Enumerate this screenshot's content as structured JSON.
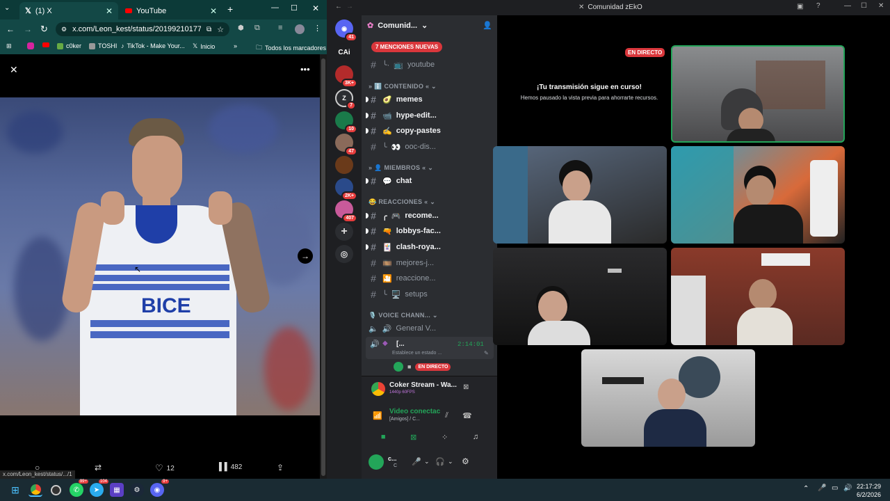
{
  "chrome": {
    "tabs": [
      {
        "label": "(1) X"
      },
      {
        "label": "YouTube"
      }
    ],
    "url": "x.com/Leon_kest/status/2019921017779...",
    "bookmarks": [
      "c0ker",
      "TOSHI",
      "TikTok - Make Your...",
      "Inicio"
    ],
    "bookmarks_more": "»",
    "all_bookmarks": "Todos los marcadores",
    "status_url": "x.com/Leon_kest/status/.../1",
    "actions": {
      "likes": "12",
      "views": "482"
    }
  },
  "discord": {
    "window_title": "Comunidad zEkO",
    "server_name": "Comunid...",
    "mentions_banner": "7 MENCIONES NUEVAS",
    "guild_badges": [
      "41",
      "3K+",
      "7",
      "10",
      "47",
      "2K+",
      "407"
    ],
    "guild_label_cai": "CAi",
    "channels": [
      {
        "name": "youtube",
        "emoji": "📺",
        "unread": false,
        "thread": true
      },
      {
        "category": "CONTENIDO",
        "emoji": "ℹ️"
      },
      {
        "name": "memes",
        "emoji": "🥑",
        "unread": true
      },
      {
        "name": "hype-edit...",
        "emoji": "📹",
        "unread": true
      },
      {
        "name": "copy-pastes",
        "emoji": "✍️",
        "unread": true
      },
      {
        "name": "ooc-dis...",
        "emoji": "👀",
        "unread": false,
        "thread": true
      },
      {
        "category": "MIEMBROS",
        "emoji": "👤"
      },
      {
        "name": "chat",
        "emoji": "💬",
        "unread": true
      },
      {
        "category": "REACCIONES",
        "emoji": "😂"
      },
      {
        "name": "recome...",
        "emoji": "🎮",
        "unread": true,
        "thread": true
      },
      {
        "name": "lobbys-fac...",
        "emoji": "🔫",
        "unread": true
      },
      {
        "name": "clash-roya...",
        "emoji": "🃏",
        "unread": true
      },
      {
        "name": "mejores-j...",
        "emoji": "🎞️",
        "unread": false
      },
      {
        "name": "reaccione...",
        "emoji": "",
        "unread": false
      },
      {
        "name": "setups",
        "emoji": "🖥️",
        "unread": false,
        "thread": true
      },
      {
        "category": "VOICE CHANN...",
        "emoji": "🎙️"
      }
    ],
    "voice_general": "General V...",
    "voice_user": "[...",
    "voice_timer": "2:14:01",
    "voice_status": "Establece un estado ...",
    "live_badge": "EN DIRECTO",
    "stream": {
      "title": "Coker Stream - Wa...",
      "quality": "1440p 60FPS"
    },
    "connection": {
      "title": "Video conectac",
      "subtitle": "[Amigos] / C..."
    },
    "user": {
      "name": "c...",
      "sub": "C"
    },
    "preview_title": "¡Tu transmisión sigue en curso!",
    "preview_sub": "Hemos pausado la vista previa para ahorrarte recursos.",
    "stage_live": "EN DIRECTO"
  },
  "taskbar": {
    "time": "22:17:29",
    "date": "6/2/2026",
    "badges": {
      "whatsapp": "99+",
      "telegram": "104",
      "discord": "9+"
    }
  }
}
